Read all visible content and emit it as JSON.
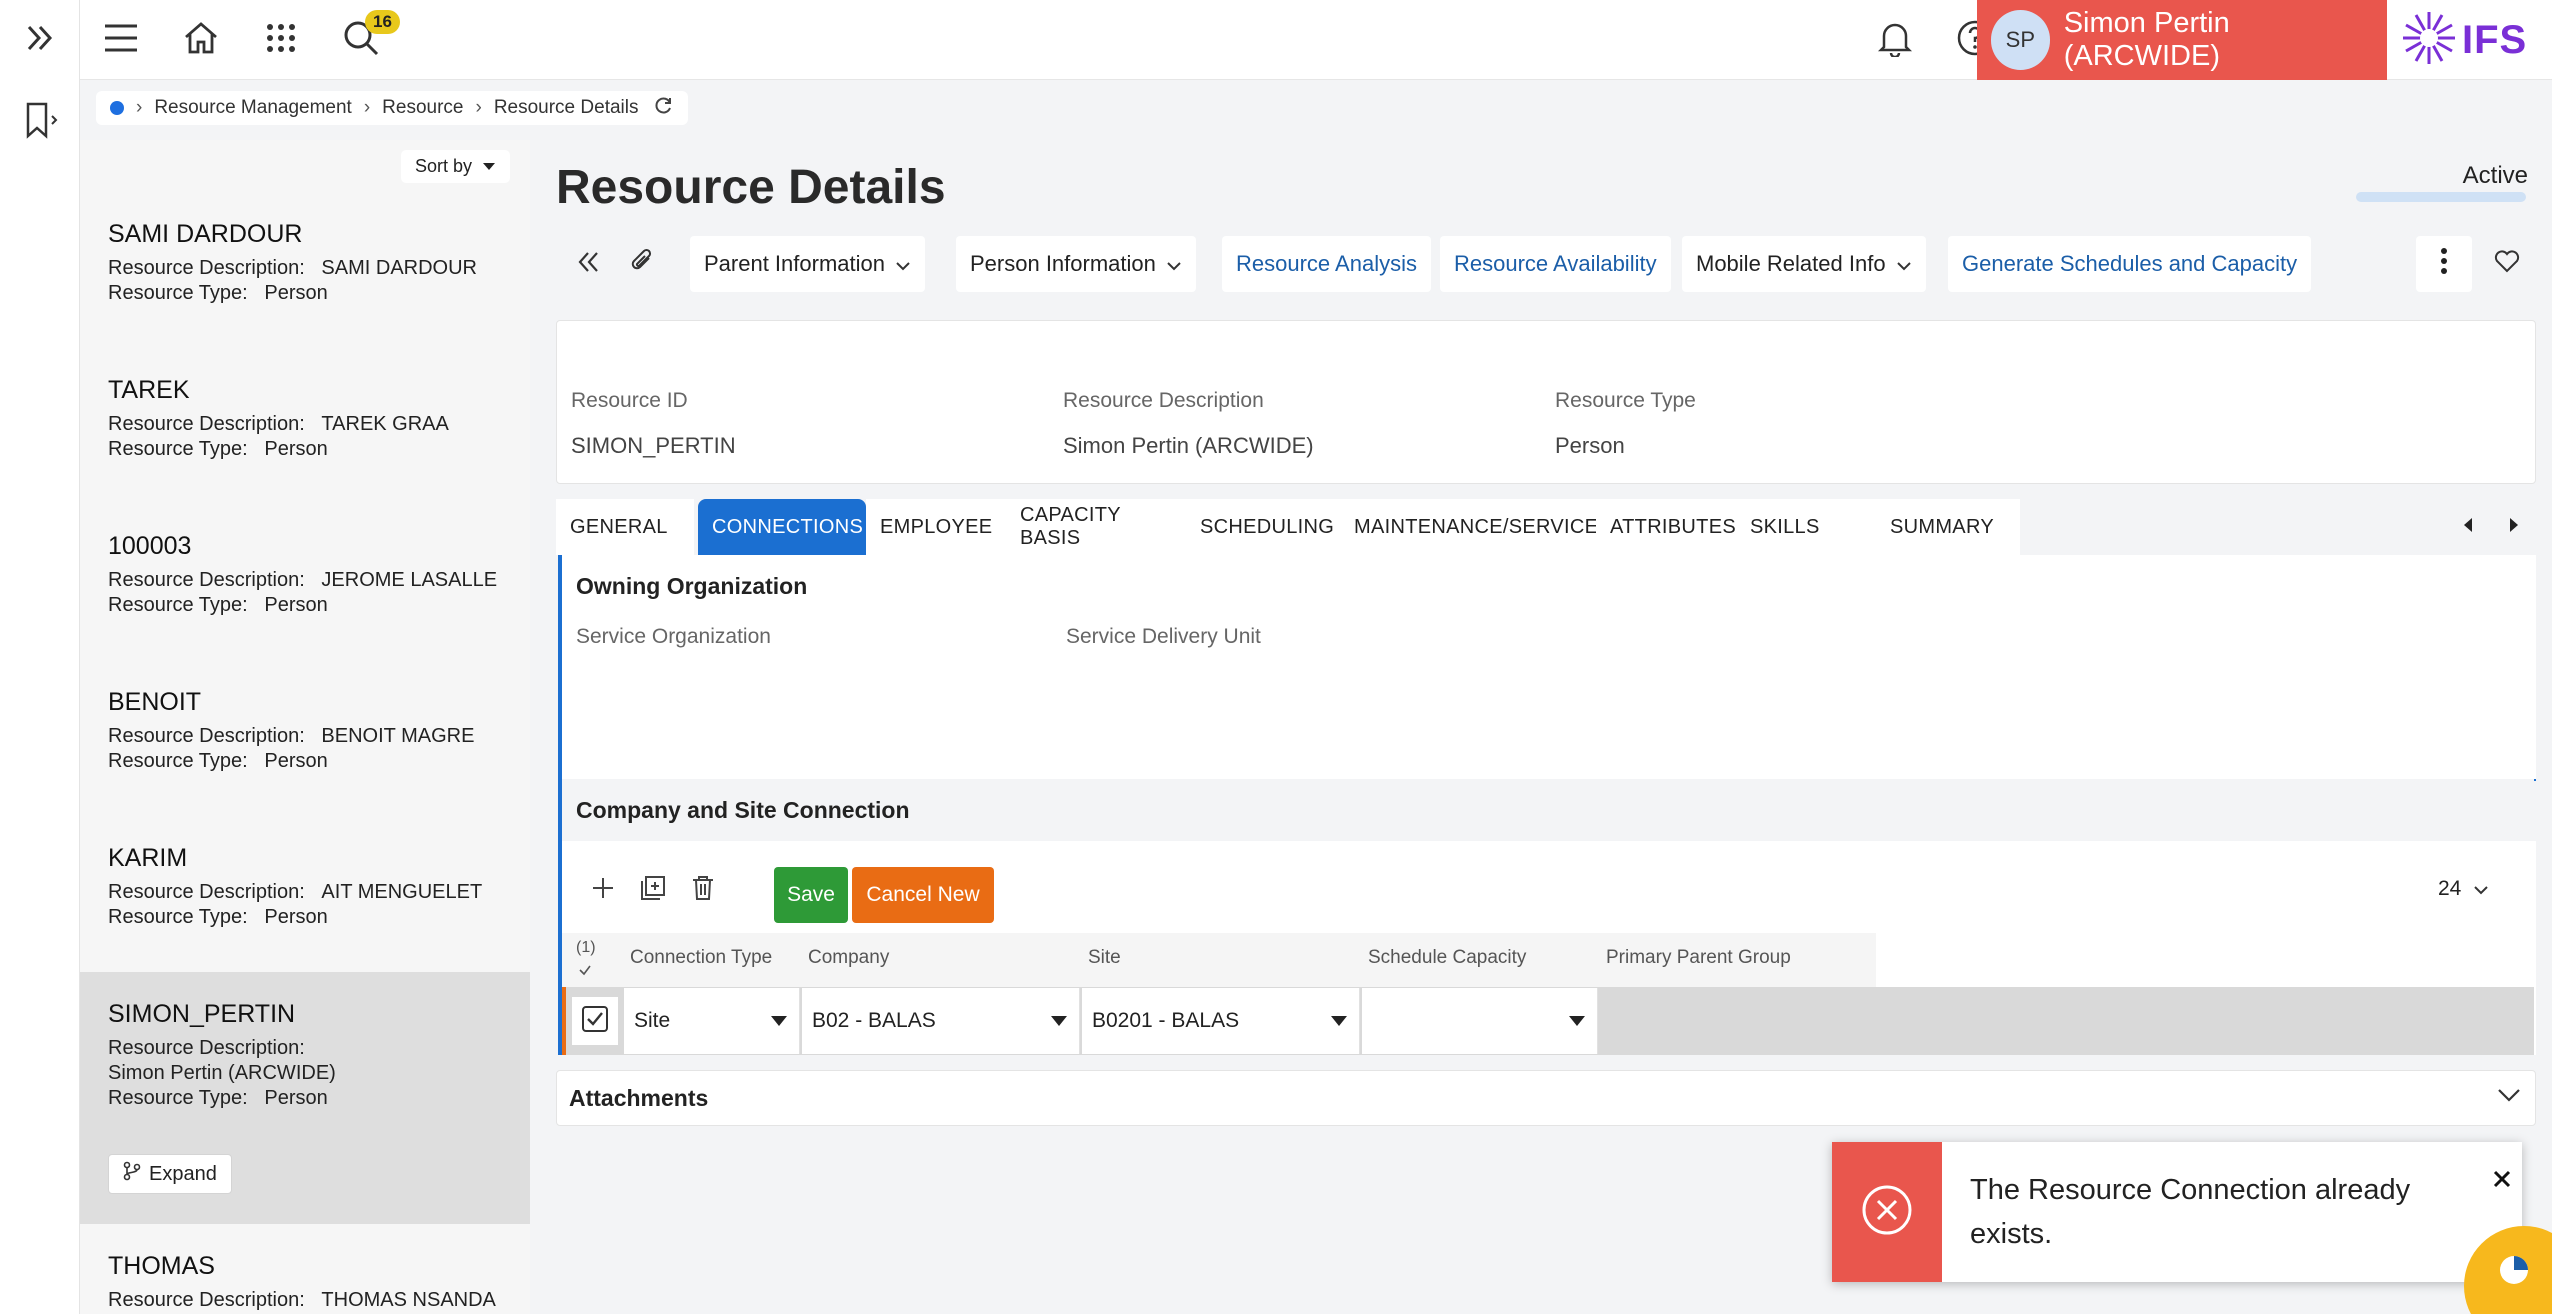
{
  "topbar": {
    "notification_count": "16",
    "user_initials": "SP",
    "user_name": "Simon Pertin (ARCWIDE)",
    "logo_text": "IFS",
    "colors": {
      "user_chip": "#e9564d",
      "badge": "#e8c81b",
      "logo": "#7a2fd6"
    }
  },
  "breadcrumb": {
    "items": [
      "Resource Management",
      "Resource",
      "Resource Details"
    ]
  },
  "sidelist": {
    "sort_label": "Sort by",
    "desc_label": "Resource Description:",
    "type_label": "Resource Type:",
    "items": [
      {
        "id": "SAMI DARDOUR",
        "description": "SAMI DARDOUR",
        "type": "Person"
      },
      {
        "id": "TAREK",
        "description": "TAREK GRAA",
        "type": "Person"
      },
      {
        "id": "100003",
        "description": "JEROME LASALLE",
        "type": "Person"
      },
      {
        "id": "BENOIT",
        "description": "BENOIT MAGRE",
        "type": "Person"
      },
      {
        "id": "KARIM",
        "description": "AIT MENGUELET",
        "type": "Person"
      },
      {
        "id": "SIMON_PERTIN",
        "description": "Simon Pertin (ARCWIDE)",
        "type": "Person"
      },
      {
        "id": "THOMAS",
        "description": "THOMAS NSANDA",
        "type": "Person"
      }
    ],
    "expand_label": "Expand"
  },
  "page": {
    "title": "Resource Details",
    "status": "Active"
  },
  "toolbar": {
    "parent_info": "Parent Information",
    "person_info": "Person Information",
    "resource_analysis": "Resource Analysis",
    "resource_availability": "Resource Availability",
    "mobile_info": "Mobile Related Info",
    "generate": "Generate Schedules and Capacity"
  },
  "header": {
    "resource_id_label": "Resource ID",
    "resource_id": "SIMON_PERTIN",
    "description_label": "Resource Description",
    "description": "Simon Pertin (ARCWIDE)",
    "type_label": "Resource Type",
    "type": "Person"
  },
  "tabs": [
    "GENERAL",
    "CONNECTIONS",
    "EMPLOYEE",
    "CAPACITY BASIS",
    "SCHEDULING",
    "MAINTENANCE/SERVICE",
    "ATTRIBUTES",
    "SKILLS",
    "SUMMARY"
  ],
  "owning_org": {
    "title": "Owning Organization",
    "service_org_label": "Service Organization",
    "service_delivery_label": "Service Delivery Unit"
  },
  "company_site": {
    "title": "Company and Site Connection",
    "save_label": "Save",
    "cancel_label": "Cancel New",
    "page_size": "24",
    "selected_count": "(1)",
    "columns": [
      "Connection Type",
      "Company",
      "Site",
      "Schedule Capacity",
      "Primary Parent Group"
    ],
    "row": {
      "connection_type": "Site",
      "company": "B02 - BALAS",
      "site": "B0201 - BALAS",
      "schedule_capacity": ""
    }
  },
  "attachments": {
    "title": "Attachments"
  },
  "toast": {
    "message": "The Resource Connection already exists."
  }
}
